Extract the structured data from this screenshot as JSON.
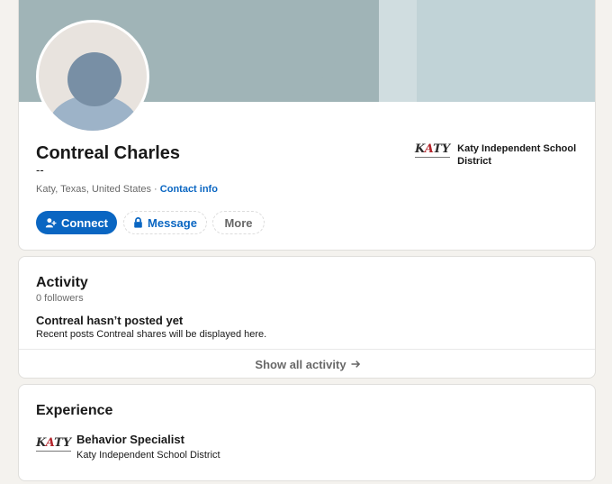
{
  "profile": {
    "name": "Contreal Charles",
    "headline": "--",
    "location": "Katy, Texas, United States",
    "location_separator": " · ",
    "contact_info_label": "Contact info",
    "current_company": {
      "name": "Katy Independent School District",
      "logo_text_k": "K",
      "logo_text_a": "A",
      "logo_text_ty": "TY"
    }
  },
  "actions": {
    "connect_label": "Connect",
    "message_label": "Message",
    "more_label": "More"
  },
  "activity": {
    "title": "Activity",
    "followers": "0 followers",
    "empty_title": "Contreal hasn’t posted yet",
    "empty_subtitle": "Recent posts Contreal shares will be displayed here.",
    "show_all_label": "Show all activity"
  },
  "experience": {
    "title": "Experience",
    "items": [
      {
        "title": "Behavior Specialist",
        "company": "Katy Independent School District"
      }
    ]
  },
  "icons": {
    "connect": "add-person-icon",
    "message": "lock-icon",
    "show_all": "arrow-right-icon",
    "company": "katy-isd-logo"
  },
  "colors": {
    "accent": "#0a66c2",
    "banner": "#a0b4b7",
    "page_background": "#f4f2ee"
  }
}
